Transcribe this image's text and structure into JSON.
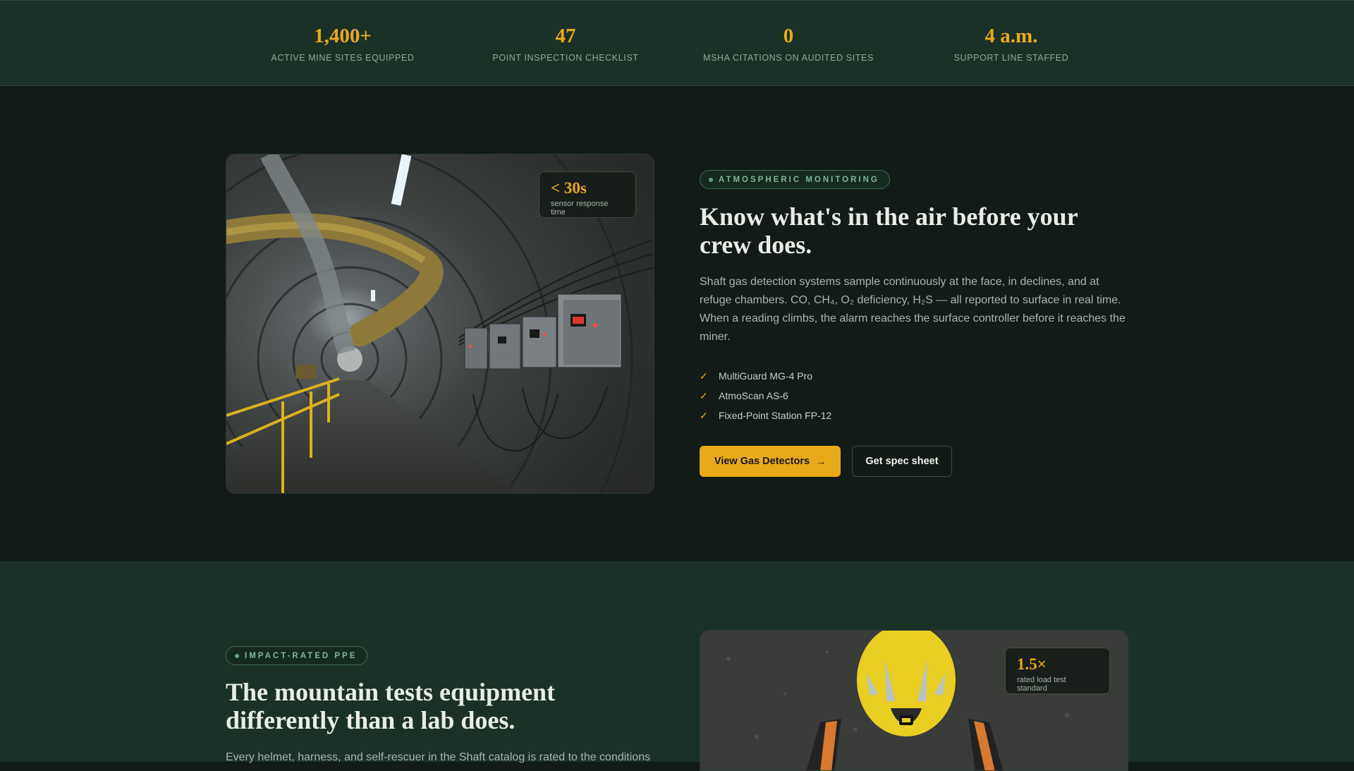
{
  "stats": [
    {
      "value": "1,400+",
      "label": "ACTIVE MINE SITES EQUIPPED"
    },
    {
      "value": "47",
      "label": "POINT INSPECTION CHECKLIST"
    },
    {
      "value": "0",
      "label": "MSHA CITATIONS ON AUDITED SITES"
    },
    {
      "value": "4 a.m.",
      "label": "SUPPORT LINE STAFFED"
    }
  ],
  "monitoring": {
    "image_badge": {
      "value": "< 30s",
      "caption": "sensor response time"
    },
    "tag": "ATMOSPHERIC MONITORING",
    "heading": "Know what's in the air before your crew does.",
    "body": "Shaft gas detection systems sample continuously at the face, in declines, and at refuge chambers. CO, CH₄, O₂ deficiency, H₂S — all reported to surface in real time. When a reading climbs, the alarm reaches the surface controller before it reaches the miner.",
    "products": [
      "MultiGuard MG-4 Pro",
      "AtmoScan AS-6",
      "Fixed-Point Station FP-12"
    ],
    "primary_button": "View Gas Detectors",
    "secondary_button": "Get spec sheet"
  },
  "ppe": {
    "tag": "IMPACT-RATED PPE",
    "heading": "The mountain tests equipment differently than a lab does.",
    "body": "Every helmet, harness, and self-rescuer in the Shaft catalog is rated to the conditions",
    "image_badge": {
      "value": "1.5×",
      "caption": "rated load test standard"
    }
  },
  "icons": {
    "check": "check-icon",
    "arrow": "arrow-right-icon"
  },
  "colors": {
    "accent": "#e8a919",
    "band": "#1b3128",
    "dark": "#121b17"
  }
}
